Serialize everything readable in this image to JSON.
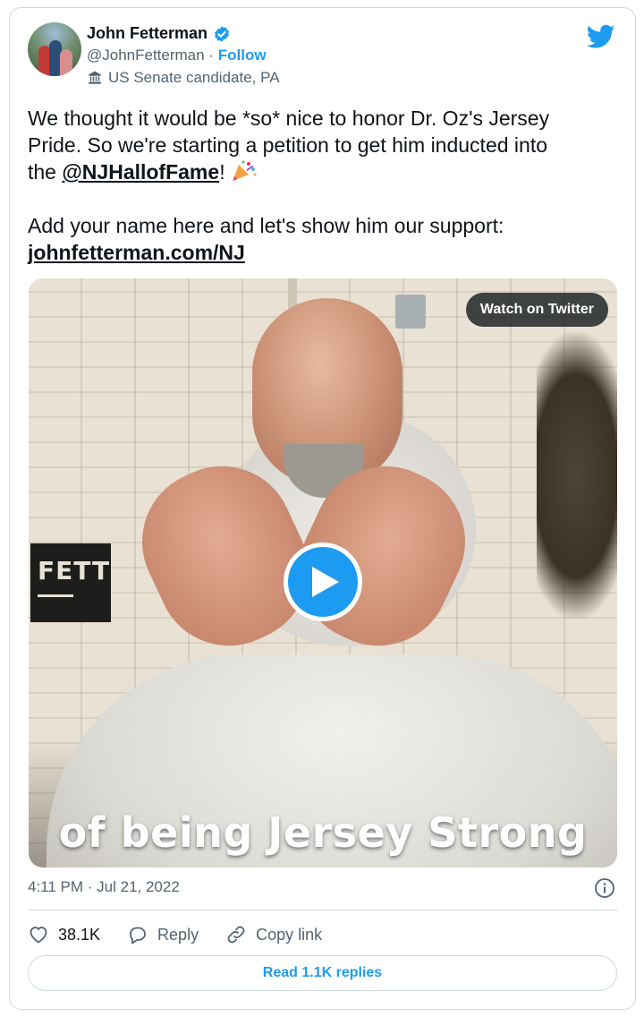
{
  "author": {
    "name": "John Fetterman",
    "handle": "@JohnFetterman",
    "separator": "·",
    "follow_label": "Follow",
    "account_label": "US Senate candidate, PA",
    "verified_icon": "verified-badge-icon",
    "label_icon": "government-building-icon"
  },
  "brand": {
    "logo": "twitter-bird-icon",
    "accent_color": "#1d9bf0"
  },
  "tweet": {
    "line1": "We thought it would be *so* nice to honor Dr. Oz's Jersey",
    "line2": "Pride. So we're starting a petition to get him inducted into",
    "line3_prefix": "the ",
    "mention": "@NJHallofFame",
    "line3_suffix": "! ",
    "emoji": "party-popper-icon",
    "line4": "Add your name here and let's show him our support:",
    "link": "johnfetterman.com/NJ"
  },
  "media": {
    "watch_label": "Watch on Twitter",
    "play_icon": "play-icon",
    "caption": "of being Jersey Strong",
    "sign_text": "FETT"
  },
  "footer": {
    "timestamp": "4:11 PM · Jul 21, 2022",
    "info_icon": "info-icon",
    "likes_count": "38.1K",
    "reply_label": "Reply",
    "copy_link_label": "Copy link",
    "read_replies_label": "Read 1.1K replies"
  }
}
